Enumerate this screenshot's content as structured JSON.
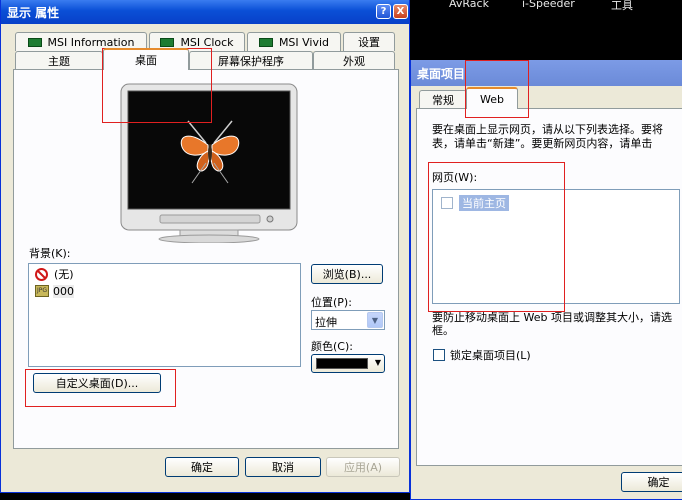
{
  "desktop": {
    "top_labels": [
      "AvRack",
      "i-Speeder",
      "工具"
    ]
  },
  "display_window": {
    "title": "显示 属性",
    "title_buttons": [
      "?",
      "X"
    ],
    "tabs_row1": [
      "MSI Information",
      "MSI Clock",
      "MSI Vivid",
      "设置"
    ],
    "tabs_row2": [
      "主题",
      "桌面",
      "屏幕保护程序",
      "外观"
    ],
    "background_label": "背景(K):",
    "background_items": [
      {
        "icon": "none-icon",
        "label": "(无)"
      },
      {
        "icon": "jpeg-icon",
        "label": "000"
      }
    ],
    "browse_button": "浏览(B)...",
    "position_label": "位置(P):",
    "position_value": "拉伸",
    "color_label": "颜色(C):",
    "color_value": "#000000",
    "customize_button": "自定义桌面(D)...",
    "ok_button": "确定",
    "cancel_button": "取消",
    "apply_button": "应用(A)"
  },
  "desktop_items_window": {
    "title": "桌面项目",
    "tabs": [
      "常规",
      "Web"
    ],
    "description_line1": "要在桌面上显示网页，请从以下列表选择。要将",
    "description_line2": "表，请单击“新建”。要更新网页内容，请单击",
    "webpages_label": "网页(W):",
    "webpage_item": "当前主页",
    "lock_note_line1": "要防止移动桌面上 Web 项目或调整其大小，请选",
    "lock_note_line2": "框。",
    "lock_checkbox_label": "锁定桌面项目(L)",
    "ok_button": "确定"
  }
}
